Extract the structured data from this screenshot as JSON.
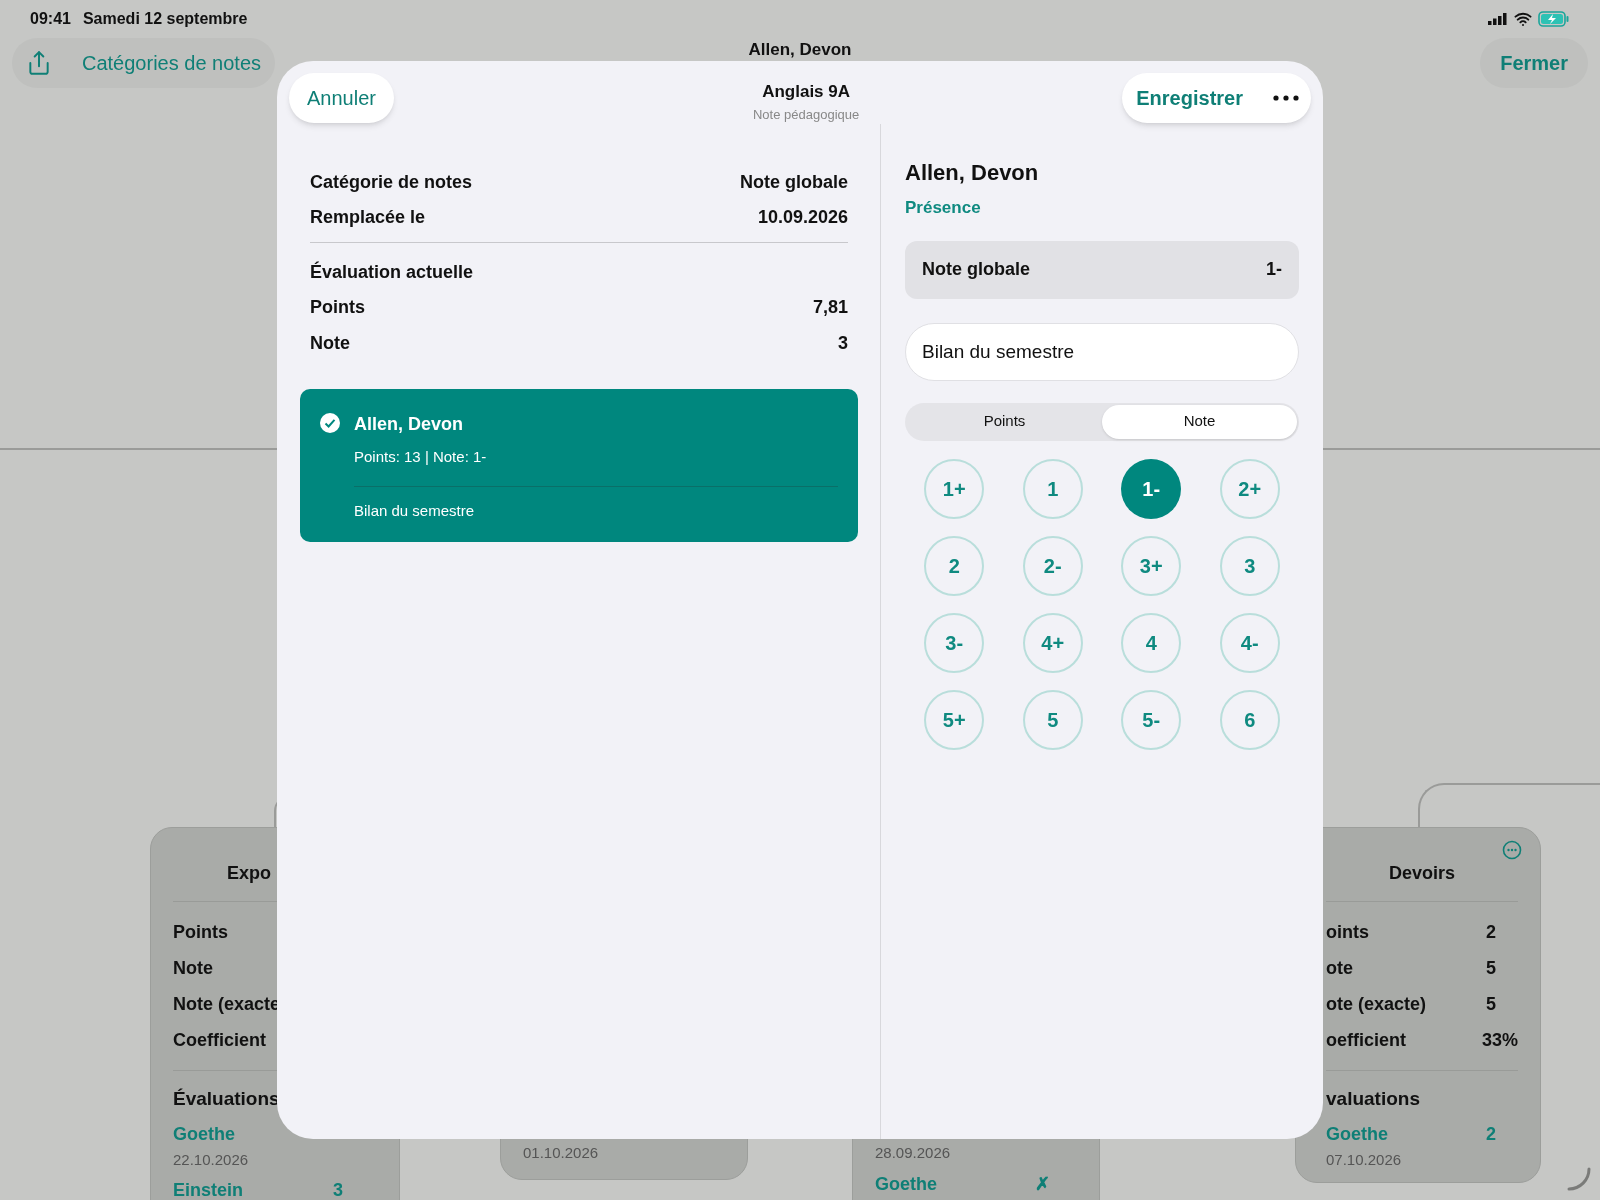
{
  "status_bar": {
    "time": "09:41",
    "date": "Samedi 12 septembre"
  },
  "toolbar": {
    "categories_link": "Catégories de notes",
    "title": "Allen, Devon",
    "close": "Fermer"
  },
  "background_cards": [
    {
      "title": "Expo",
      "rows": [
        {
          "label": "Points"
        },
        {
          "label": "Note"
        },
        {
          "label": "Note (exacte"
        },
        {
          "label": "Coefficient"
        }
      ],
      "section": "Évaluations",
      "evaluations": [
        {
          "name": "Goethe",
          "date": "22.10.2026"
        },
        {
          "name": "Einstein",
          "value": "3"
        }
      ]
    },
    {
      "evaluations": [
        {
          "date": "01.10.2026"
        }
      ]
    },
    {
      "evaluations": [
        {
          "date": "28.09.2026"
        },
        {
          "name": "Goethe",
          "value": "✗"
        }
      ]
    },
    {
      "title": "Devoirs",
      "menu": true,
      "rows": [
        {
          "label": "oints",
          "value": "2"
        },
        {
          "label": "ote",
          "value": "5"
        },
        {
          "label": "ote (exacte)",
          "value": "5"
        },
        {
          "label": "oefficient",
          "value": "33%"
        }
      ],
      "section": "valuations",
      "evaluations": [
        {
          "name": "Goethe",
          "value": "2",
          "date": "07.10.2026"
        }
      ]
    }
  ],
  "modal": {
    "cancel": "Annuler",
    "title": "Anglais 9A",
    "subtitle": "Note pédagogique",
    "save": "Enregistrer",
    "summary": [
      {
        "label": "Catégorie de notes",
        "value": "Note globale"
      },
      {
        "label": "Remplacée le",
        "value": "10.09.2026"
      }
    ],
    "current_heading": "Évaluation actuelle",
    "current": [
      {
        "label": "Points",
        "value": "7,81"
      },
      {
        "label": "Note",
        "value": "3"
      }
    ],
    "entry": {
      "checked": true,
      "name": "Allen, Devon",
      "details": "Points: 13 | Note: 1-",
      "comment": "Bilan du semestre"
    },
    "student": {
      "name": "Allen, Devon",
      "attendance_link": "Présence"
    },
    "category": {
      "label": "Note globale",
      "value": "1-"
    },
    "comment_field": {
      "value": "Bilan du semestre"
    },
    "mode_tabs": [
      {
        "label": "Points",
        "selected": false
      },
      {
        "label": "Note",
        "selected": true
      }
    ],
    "grades": [
      {
        "label": "1+",
        "selected": false
      },
      {
        "label": "1",
        "selected": false
      },
      {
        "label": "1-",
        "selected": true
      },
      {
        "label": "2+",
        "selected": false
      },
      {
        "label": "2",
        "selected": false
      },
      {
        "label": "2-",
        "selected": false
      },
      {
        "label": "3+",
        "selected": false
      },
      {
        "label": "3",
        "selected": false
      },
      {
        "label": "3-",
        "selected": false
      },
      {
        "label": "4+",
        "selected": false
      },
      {
        "label": "4",
        "selected": false
      },
      {
        "label": "4-",
        "selected": false
      },
      {
        "label": "5+",
        "selected": false
      },
      {
        "label": "5",
        "selected": false
      },
      {
        "label": "5-",
        "selected": false
      },
      {
        "label": "6",
        "selected": false
      }
    ]
  }
}
